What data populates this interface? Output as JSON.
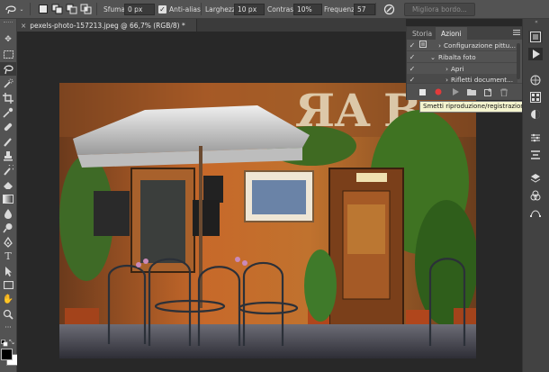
{
  "options_bar": {
    "sfuma_label": "Sfuma:",
    "sfuma_value": "0 px",
    "antialias_label": "Anti-alias",
    "larghezza_label": "Larghezza:",
    "larghezza_value": "10 px",
    "contrasto_label": "Contrasto:",
    "contrasto_value": "10%",
    "frequenza_label": "Frequenza:",
    "frequenza_value": "57",
    "migliora_bordo_label": "Migliora bordo..."
  },
  "document": {
    "tab_title": "pexels-photo-157213.jpeg @ 66,7% (RGB/8) *",
    "close_symbol": "×"
  },
  "actions_panel": {
    "tabs": [
      "Storia",
      "Azioni"
    ],
    "active_tab": "Azioni",
    "rows": [
      {
        "label": "Configurazione pittu...",
        "check": "✓",
        "indent": 2,
        "expander": "›"
      },
      {
        "label": "Ribalta foto",
        "check": "✓",
        "indent": 1,
        "expander": "⌄"
      },
      {
        "label": "Apri",
        "check": "✓",
        "indent": 2,
        "expander": "›"
      },
      {
        "label": "Rifletti document...",
        "check": "✓",
        "indent": 2,
        "expander": "›"
      }
    ],
    "tooltip": "Smetti riproduzione/registrazione"
  },
  "colors": {
    "ui_dark": "#282828",
    "ui_panel": "#535353",
    "record_red": "#e23b3b"
  },
  "icons": {
    "left_toolbar": [
      "move-tool-icon",
      "marquee-tool-icon",
      "lasso-tool-icon",
      "quick-select-tool-icon",
      "crop-tool-icon",
      "eyedropper-tool-icon",
      "healing-brush-icon",
      "brush-tool-icon",
      "clone-stamp-icon",
      "history-brush-icon",
      "eraser-icon",
      "gradient-icon",
      "blur-icon",
      "dodge-icon",
      "pen-tool-icon",
      "type-tool-icon",
      "path-select-icon",
      "rectangle-tool-icon",
      "hand-tool-icon",
      "zoom-tool-icon"
    ]
  }
}
